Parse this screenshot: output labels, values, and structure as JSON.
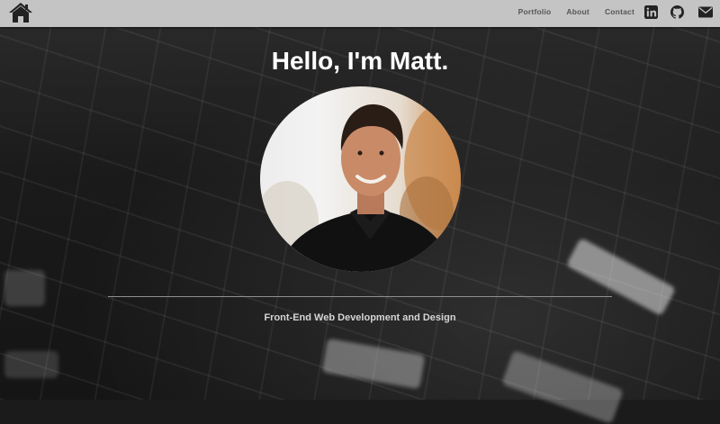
{
  "navbar": {
    "home_icon": "home-icon",
    "links": [
      {
        "label": "Portfolio"
      },
      {
        "label": "About"
      },
      {
        "label": "Contact"
      }
    ],
    "social": [
      {
        "icon": "linkedin-icon"
      },
      {
        "icon": "github-icon"
      },
      {
        "icon": "envelope-icon"
      }
    ]
  },
  "hero": {
    "headline": "Hello, I'm Matt.",
    "tagline": "Front-End Web Development and Design"
  },
  "colors": {
    "navbar_bg": "#c4c4c4",
    "nav_text": "#555555",
    "headline": "#ffffff",
    "tagline": "#d5d5d5"
  }
}
